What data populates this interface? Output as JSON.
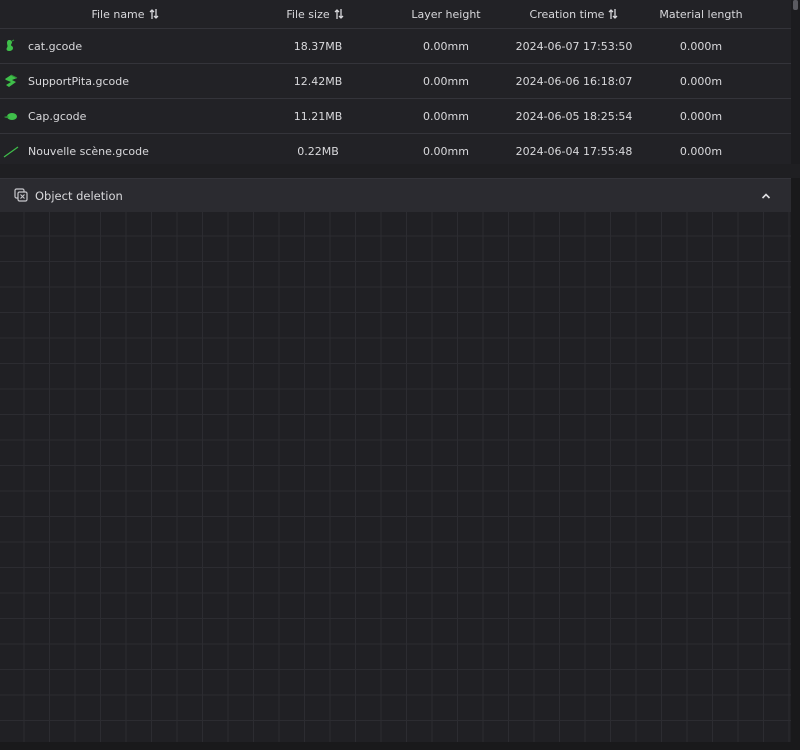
{
  "table": {
    "headers": {
      "file_name": "File name",
      "file_size": "File size",
      "layer_height": "Layer height",
      "creation_time": "Creation time",
      "material_length": "Material length"
    },
    "sortable_icon": "sort-arrows-icon",
    "rows": [
      {
        "icon": "green-model-icon",
        "name": "cat.gcode",
        "size": "18.37MB",
        "layer": "0.00mm",
        "time": "2024-06-07 17:53:50",
        "material": "0.000m"
      },
      {
        "icon": "green-model-icon",
        "name": "SupportPita.gcode",
        "size": "12.42MB",
        "layer": "0.00mm",
        "time": "2024-06-06 16:18:07",
        "material": "0.000m"
      },
      {
        "icon": "green-model-icon",
        "name": "Cap.gcode",
        "size": "11.21MB",
        "layer": "0.00mm",
        "time": "2024-06-05 18:25:54",
        "material": "0.000m"
      },
      {
        "icon": "green-line-icon",
        "name": "Nouvelle scène.gcode",
        "size": "0.22MB",
        "layer": "0.00mm",
        "time": "2024-06-04 17:55:48",
        "material": "0.000m"
      }
    ]
  },
  "panel": {
    "title": "Object deletion",
    "icon": "object-delete-icon",
    "chevron": "chevron-up-icon"
  },
  "colors": {
    "background": "#1f1f22",
    "accent_green": "#3fbf4a",
    "text": "#d9d9dc"
  }
}
